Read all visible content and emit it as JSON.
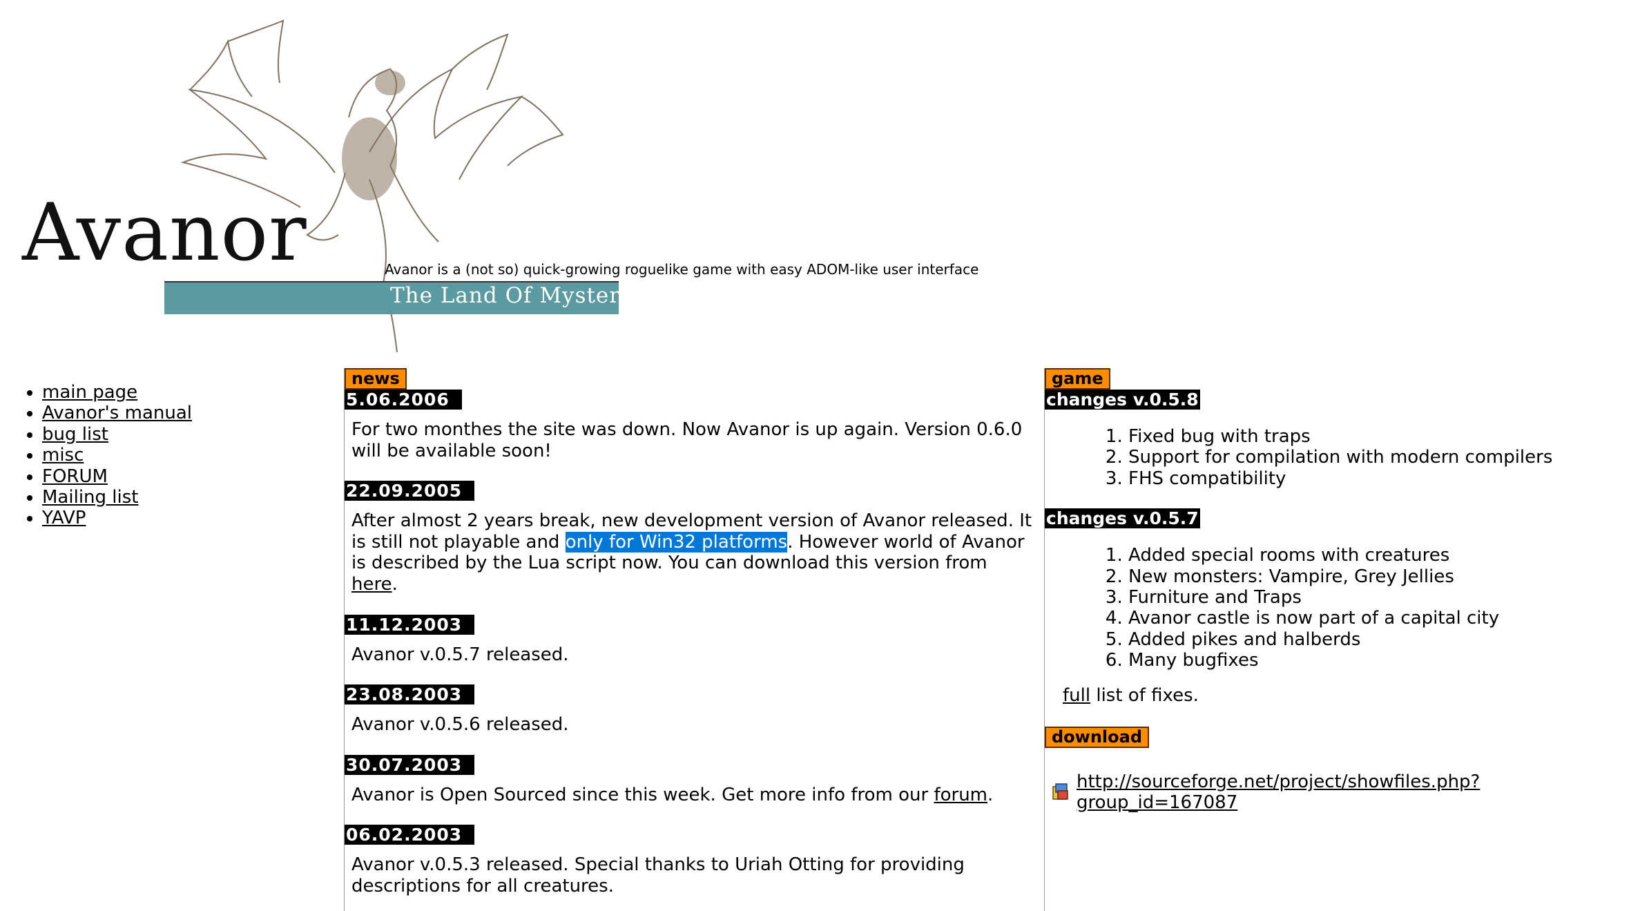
{
  "logo": {
    "word": "Avanor",
    "subtitle": "The Land Of Mystery"
  },
  "tagline": "Avanor is a (not so) quick-growing roguelike game with easy ADOM-like user interface",
  "nav": [
    "main page",
    "Avanor's manual",
    "bug list",
    "misc",
    "FORUM",
    "Mailing list",
    "YAVP"
  ],
  "news": {
    "tab": "news",
    "items": [
      {
        "date": "5.06.2006",
        "text": "For two monthes the site was down. Now Avanor is up again. Version 0.6.0 will be available soon!"
      },
      {
        "date": "22.09.2005",
        "text_a": "After almost 2 years break, new development version of Avanor released. It is still not playable and ",
        "text_hl": "only for Win32 platforms",
        "text_b": ". However world of Avanor is described by the Lua script now. You can download this version from ",
        "link": "here",
        "text_c": "."
      },
      {
        "date": "11.12.2003",
        "text": "Avanor v.0.5.7 released."
      },
      {
        "date": "23.08.2003",
        "text": "Avanor v.0.5.6 released."
      },
      {
        "date": "30.07.2003",
        "text_a": "Avanor is Open Sourced since this week. Get more info from our ",
        "link": "forum",
        "text_b": "."
      },
      {
        "date": "06.02.2003",
        "text": "Avanor v.0.5.3 released. Special thanks to Uriah Otting for providing descriptions for all creatures."
      }
    ]
  },
  "game": {
    "tab": "game",
    "versions": [
      {
        "title": "changes v.0.5.8",
        "items": [
          "Fixed bug with traps",
          "Support for compilation with modern compilers",
          "FHS compatibility"
        ]
      },
      {
        "title": "changes v.0.5.7",
        "items": [
          "Added special rooms with creatures",
          "New monsters: Vampire, Grey Jellies",
          "Furniture and Traps",
          "Avanor castle is now part of a capital city",
          "Added pikes and halberds",
          "Many bugfixes"
        ]
      }
    ],
    "full_link": "full",
    "full_rest": " list of fixes."
  },
  "download": {
    "tab": "download",
    "url": "http://sourceforge.net/project/showfiles.php?group_id=167087",
    "icon": "package-icon"
  },
  "colors": {
    "tab": "#ff8c00",
    "band": "#5a9aa0",
    "selection": "#0078d7"
  }
}
